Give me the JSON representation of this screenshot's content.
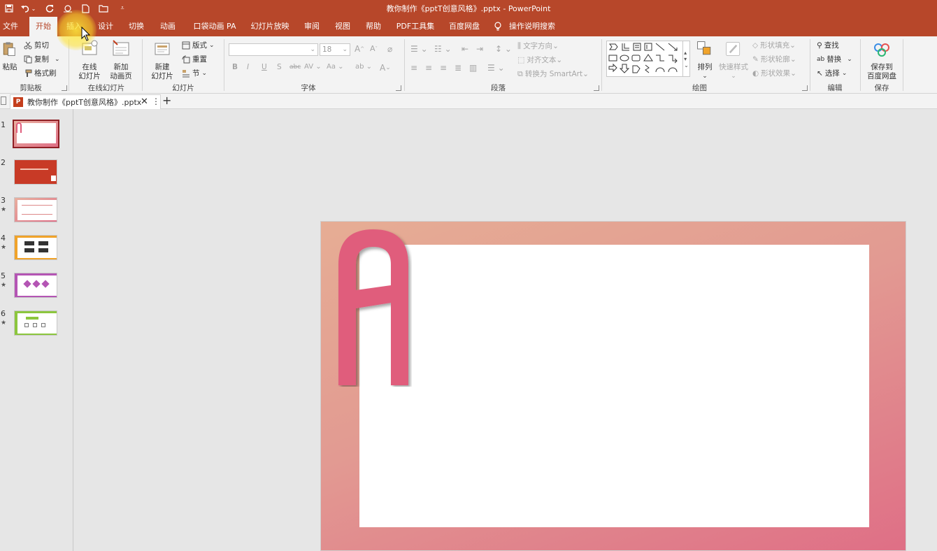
{
  "window": {
    "title": "教你制作《pptT创意风格》.pptx  -  PowerPoint"
  },
  "quick_access": {
    "items": [
      "save-icon",
      "undo-icon",
      "redo-icon",
      "touch-mode-icon",
      "new-file-icon",
      "open-folder-icon",
      "customize-icon"
    ]
  },
  "tabs": {
    "items": [
      {
        "label": "文件"
      },
      {
        "label": "开始"
      },
      {
        "label": "插入"
      },
      {
        "label": "设计"
      },
      {
        "label": "切换"
      },
      {
        "label": "动画"
      },
      {
        "label": "口袋动画 PA"
      },
      {
        "label": "幻灯片放映"
      },
      {
        "label": "审阅"
      },
      {
        "label": "视图"
      },
      {
        "label": "帮助"
      },
      {
        "label": "PDF工具集"
      },
      {
        "label": "百度网盘"
      }
    ],
    "active": "开始",
    "tell_me": "操作说明搜索"
  },
  "ribbon": {
    "clipboard": {
      "paste": "粘贴",
      "cut": "剪切",
      "copy": "复制",
      "format_painter": "格式刷",
      "label": "剪贴板"
    },
    "online_slides": {
      "online": "在线",
      "online2": "幻灯片",
      "new_anim": "新加",
      "new_anim2": "动画页",
      "label": "在线幻灯片"
    },
    "slides": {
      "new_slide": "新建",
      "new_slide2": "幻灯片",
      "layout": "版式",
      "reset": "重置",
      "section": "节",
      "label": "幻灯片"
    },
    "font": {
      "size": "18",
      "label": "字体"
    },
    "paragraph": {
      "text_direction": "文字方向",
      "align_text": "对齐文本",
      "smartart": "转换为 SmartArt",
      "label": "段落"
    },
    "drawing": {
      "arrange": "排列",
      "quick_styles": "快速样式",
      "shape_fill": "形状填充",
      "shape_outline": "形状轮廓",
      "shape_effects": "形状效果",
      "label": "绘图"
    },
    "editing": {
      "find": "查找",
      "replace": "替换",
      "select": "选择",
      "label": "编辑"
    },
    "save": {
      "save_to": "保存到",
      "save_to2": "百度网盘",
      "label": "保存"
    }
  },
  "document_tab": {
    "name": "教你制作《pptT创意风格》.pptx",
    "pp_letter": "P"
  },
  "thumbnails": {
    "items": [
      {
        "num": "1",
        "star": ""
      },
      {
        "num": "2",
        "star": ""
      },
      {
        "num": "3",
        "star": "★"
      },
      {
        "num": "4",
        "star": "★"
      },
      {
        "num": "5",
        "star": "★"
      },
      {
        "num": "6",
        "star": "★"
      }
    ]
  },
  "colors": {
    "accent": "#b7472a",
    "slide_border_start": "#e6ad94",
    "slide_border_end": "#df6f86",
    "letter": "#e05d7c"
  }
}
